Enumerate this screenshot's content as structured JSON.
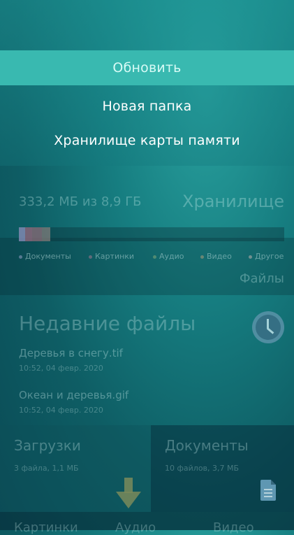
{
  "pulley_menu": {
    "items": [
      {
        "label": "Обновить"
      },
      {
        "label": "Новая папка"
      },
      {
        "label": "Хранилище карты памяти"
      }
    ]
  },
  "storage": {
    "used_text": "333,2 МБ из 8,9 ГБ",
    "title": "Хранилище",
    "usage_bar_fraction": 0.036,
    "legend": [
      {
        "label": "Документы",
        "color": "#9fa6cf"
      },
      {
        "label": "Картинки",
        "color": "#b07a90"
      },
      {
        "label": "Аудио",
        "color": "#8fae7a"
      },
      {
        "label": "Видео",
        "color": "#b9a27a"
      },
      {
        "label": "Другое",
        "color": "#cdb8b3"
      }
    ],
    "files_link": "Файлы"
  },
  "recent": {
    "title": "Недавние файлы",
    "icon": "clock-icon",
    "files": [
      {
        "name": "Деревья в снегу.tif",
        "meta": "10:52, 04 февр. 2020"
      },
      {
        "name": "Океан и деревья.gif",
        "meta": "10:52, 04 февр. 2020"
      }
    ]
  },
  "tiles": {
    "downloads": {
      "title": "Загрузки",
      "meta": "3 файла, 1,1 МБ",
      "icon": "download-arrow-icon"
    },
    "documents": {
      "title": "Документы",
      "meta": "10 файлов, 3,7 МБ",
      "icon": "document-icon"
    }
  },
  "bottom_row": [
    "Картинки",
    "Аудио",
    "Видео"
  ]
}
